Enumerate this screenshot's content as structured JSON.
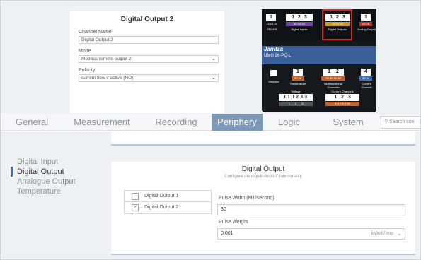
{
  "dialog": {
    "title": "Digital Output 2",
    "channel_name_label": "Channel Name",
    "channel_name_value": "Digital Output 2",
    "mode_label": "Mode",
    "mode_value": "Modbus remote output 2",
    "polarity_label": "Polarity",
    "polarity_value": "current flow if active (NO)"
  },
  "device": {
    "brand": "Janitza",
    "model": "UMG 96-PQ-L",
    "top_terminals": [
      {
        "num": "1",
        "label": "RS-485",
        "pins": "14 15 16"
      },
      {
        "num": "1 2 3",
        "label": "Digital Inputs",
        "pins": "18 19 20"
      },
      {
        "num": "1 2 3",
        "label": "Digital Outputs",
        "pins": "22 23 24"
      },
      {
        "num": "1",
        "label": "Analog Output",
        "pins": "25 26"
      }
    ],
    "mid_terminals": [
      {
        "num": "",
        "label": "Ethernet"
      },
      {
        "num": "1",
        "label": "Temperature",
        "pins": "27 28"
      },
      {
        "num": "1 2",
        "label": "Multifunctional Channels",
        "pins": "29 30 31 32"
      },
      {
        "num": "4",
        "label": "Current Channel",
        "pins": "33 34"
      }
    ],
    "voltage_label": "Voltage",
    "voltage_terminals": "L1 L2 L3",
    "voltage_pins": "1 2 3",
    "current_label": "Current Channels",
    "current_terminals": "1 2 3",
    "current_pins": "5 6 7 8 9 10"
  },
  "tabs": [
    "General",
    "Measurement",
    "Recording",
    "Periphery",
    "Logic",
    "System"
  ],
  "active_tab": "Periphery",
  "search_placeholder": "Search con",
  "sidebar": [
    "Digital Input",
    "Digital Output",
    "Analogue Output",
    "Temperature"
  ],
  "active_sidebar": "Digital Output",
  "card": {
    "title": "Digital Output",
    "subtitle": "Configure the digital outputs' functionality",
    "outputs": [
      {
        "label": "Digital Output 1",
        "checked": false
      },
      {
        "label": "Digital Output 2",
        "checked": true
      }
    ],
    "pulse_width_label": "Pulse Width (Millisecond)",
    "pulse_width_value": "30",
    "pulse_weight_label": "Pulse Weight",
    "pulse_weight_value": "0.001",
    "pulse_weight_unit": "kVarh/Imp"
  },
  "colors": {
    "accent": "#7e99b8",
    "highlight": "#e02020",
    "sidebar_marker": "#3d6eb4",
    "device_band": "#3a5f99"
  }
}
